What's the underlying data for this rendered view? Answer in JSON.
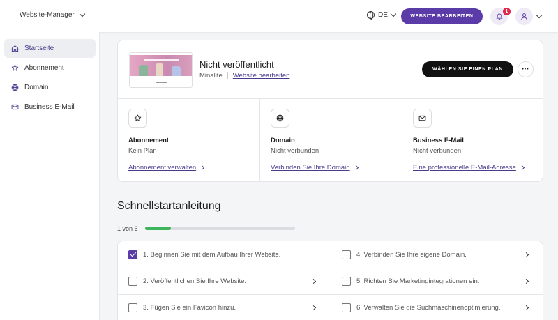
{
  "header": {
    "site_switch_label": "Website-Manager",
    "language": "DE",
    "edit_website_button": "WEBSITE BEARBEITEN",
    "notification_count": "1"
  },
  "sidebar": {
    "items": [
      {
        "label": "Startseite",
        "icon": "home-icon",
        "active": true
      },
      {
        "label": "Abonnement",
        "icon": "star-icon",
        "active": false
      },
      {
        "label": "Domain",
        "icon": "globe-icon",
        "active": false
      },
      {
        "label": "Business E-Mail",
        "icon": "mail-icon",
        "active": false
      }
    ]
  },
  "site_card": {
    "thumbnail_caption": "Handmade ceramics",
    "status_title": "Nicht veröffentlicht",
    "template_name": "Minalite",
    "edit_link": "Website bearbeiten",
    "choose_plan_button": "WÄHLEN SIE EINEN PLAN",
    "more_button": "•••",
    "columns": [
      {
        "icon": "star-icon",
        "title": "Abonnement",
        "value": "Kein Plan",
        "link": "Abonnement verwalten"
      },
      {
        "icon": "globe-icon",
        "title": "Domain",
        "value": "Nicht verbunden",
        "link": "Verbinden Sie Ihre Domain"
      },
      {
        "icon": "mail-icon",
        "title": "Business E-Mail",
        "value": "Nicht verbunden",
        "link": "Eine professionelle E-Mail-Adresse"
      }
    ]
  },
  "quickstart": {
    "title": "Schnellstartanleitung",
    "progress_text": "1 von 6",
    "progress_fraction": 0.17,
    "steps": [
      {
        "label": "1. Beginnen Sie mit dem Aufbau Ihrer Website.",
        "checked": true
      },
      {
        "label": "2. Veröffentlichen Sie Ihre Website.",
        "checked": false
      },
      {
        "label": "3. Fügen Sie ein Favicon hinzu.",
        "checked": false
      },
      {
        "label": "4. Verbinden Sie Ihre eigene Domain.",
        "checked": false
      },
      {
        "label": "5. Richten Sie Marketingintegrationen ein.",
        "checked": false
      },
      {
        "label": "6. Verwalten Sie die Suchmaschinenoptimierung.",
        "checked": false
      }
    ]
  },
  "colors": {
    "accent": "#5b3ba8",
    "progress": "#3cb55b",
    "badge": "#e0264b"
  }
}
